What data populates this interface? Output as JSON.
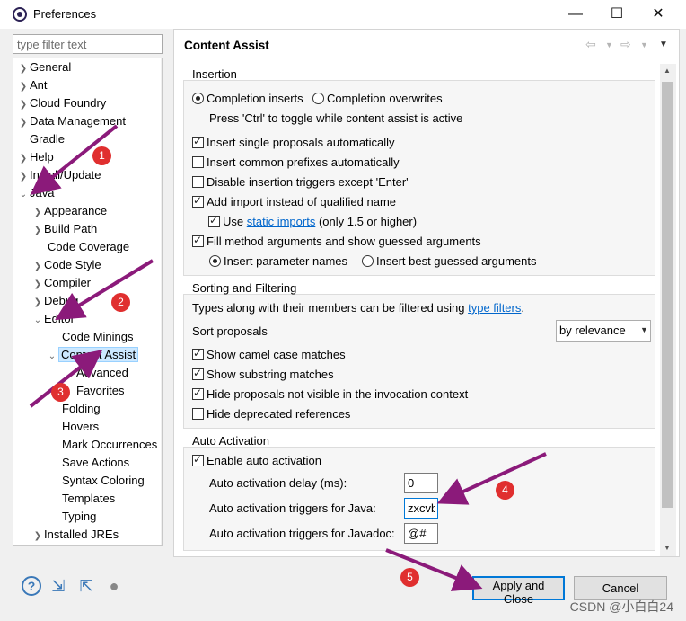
{
  "window": {
    "title": "Preferences",
    "minimize": "—",
    "maximize": "☐",
    "close": "✕"
  },
  "filter": {
    "placeholder": "type filter text"
  },
  "tree": {
    "general": "General",
    "ant": "Ant",
    "cloud_foundry": "Cloud Foundry",
    "data_management": "Data Management",
    "gradle": "Gradle",
    "help": "Help",
    "install_update": "Install/Update",
    "java": "Java",
    "appearance": "Appearance",
    "build_path": "Build Path",
    "code_coverage": "Code Coverage",
    "code_style": "Code Style",
    "compiler": "Compiler",
    "debug": "Debug",
    "editor": "Editor",
    "code_minings": "Code Minings",
    "content_assist": "Content Assist",
    "advanced": "Advanced",
    "favorites": "Favorites",
    "folding": "Folding",
    "hovers": "Hovers",
    "mark_occurrences": "Mark Occurrences",
    "save_actions": "Save Actions",
    "syntax_coloring": "Syntax Coloring",
    "templates": "Templates",
    "typing": "Typing",
    "installed_jres": "Installed JREs"
  },
  "page": {
    "title": "Content Assist"
  },
  "insertion": {
    "label": "Insertion",
    "completion_inserts": "Completion inserts",
    "completion_overwrites": "Completion overwrites",
    "hint": "Press 'Ctrl' to toggle while content assist is active",
    "single_proposals": "Insert single proposals automatically",
    "common_prefixes": "Insert common prefixes automatically",
    "disable_triggers": "Disable insertion triggers except 'Enter'",
    "add_import": "Add import instead of qualified name",
    "use": "Use",
    "static_imports": "static imports",
    "only_15": "(only 1.5 or higher)",
    "fill_method_args": "Fill method arguments and show guessed arguments",
    "insert_param_names": "Insert parameter names",
    "insert_best_guessed": "Insert best guessed arguments"
  },
  "sorting": {
    "label": "Sorting and Filtering",
    "types_text": "Types along with their members can be filtered using",
    "type_filters": "type filters",
    "period": ".",
    "sort_proposals": "Sort proposals",
    "sort_value": "by relevance",
    "camel_case": "Show camel case matches",
    "substring": "Show substring matches",
    "hide_not_visible": "Hide proposals not visible in the invocation context",
    "hide_deprecated": "Hide deprecated references"
  },
  "auto_activation": {
    "label": "Auto Activation",
    "enable": "Enable auto activation",
    "delay_label": "Auto activation delay (ms):",
    "delay_value": "0",
    "java_label": "Auto activation triggers for Java:",
    "java_value": "zxcvb",
    "javadoc_label": "Auto activation triggers for Javadoc:",
    "javadoc_value": "@#"
  },
  "buttons": {
    "apply_close": "Apply and Close",
    "cancel": "Cancel"
  },
  "bottom_icons": {
    "help": "?",
    "import": "⇲",
    "export": "⇱",
    "record": "●"
  },
  "annotations": {
    "b1": "1",
    "b2": "2",
    "b3": "3",
    "b4": "4",
    "b5": "5"
  },
  "watermark": "CSDN @小白白24",
  "colors": {
    "selection": "#cce8ff",
    "link": "#0066cc",
    "annotation": "#8b1a7a",
    "badge": "#e02f2f",
    "default_button_border": "#0078d7"
  }
}
